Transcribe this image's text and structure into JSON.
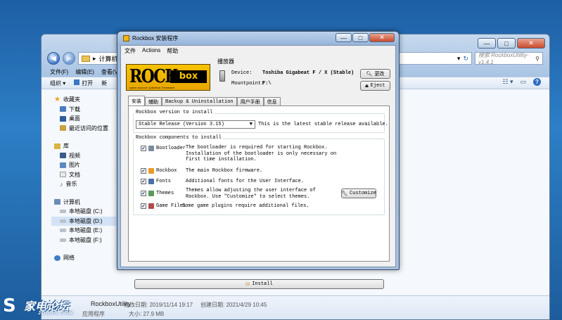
{
  "explorer": {
    "caption": {
      "minimize": "—",
      "maximize": "□",
      "close": "✕"
    },
    "breadcrumb": [
      "▸",
      "计算机",
      "▸"
    ],
    "search_placeholder": "搜索 RockboxUtility-v1.4.1",
    "menu": [
      "文件(F)",
      "编辑(E)",
      "查看(V)"
    ],
    "toolbar": {
      "organize": "组织 ▾",
      "open": "打开",
      "more": "新"
    },
    "nav": {
      "favorites": "收藏夹",
      "fav_items": [
        "下载",
        "桌面",
        "最近访问的位置"
      ],
      "libraries": "库",
      "lib_items": [
        "视频",
        "图片",
        "文档",
        "音乐"
      ],
      "computer": "计算机",
      "drives": [
        "本地磁盘 (C:)",
        "本地磁盘 (D:)",
        "本地磁盘 (E:)",
        "本地磁盘 (F:)"
      ],
      "network": "网络"
    },
    "status": {
      "name": "RockboxUtility",
      "type": "应用程序",
      "modified": "修改日期: 2019/11/14 19:17",
      "size": "大小: 27.9 MB",
      "created": "创建日期: 2021/4/29 10:45"
    }
  },
  "dialog": {
    "title": "Rockbox 安装程序",
    "menu": [
      "文件",
      "Actions",
      "帮助"
    ],
    "logo": {
      "text": "ROCK",
      "box": "box",
      "sub": "open source jukebox firmware"
    },
    "player_label": "播放器",
    "device_label": "Device:",
    "device_value": "Toshiba Gigabeat F / X (Stable)",
    "mountpoint_label": "Mountpoint:",
    "mountpoint_value": "F:\\",
    "change_button": "更改",
    "eject_button": "Eject",
    "tabs": [
      "安装",
      "辅助",
      "Backup & Uninstallation",
      "用户手册",
      "信息"
    ],
    "version_group": "Rockbox version to install",
    "version_selected": "Stable Release (Version 3.15)",
    "version_note": "This is the latest stable release available.",
    "components_group": "Rockbox components to install",
    "components": [
      {
        "name": "Bootloader",
        "desc": "The bootloader is required for starting Rockbox. Installation of the bootloader is only necessary on first time installation.",
        "color": "#7a8aa0"
      },
      {
        "name": "Rockbox",
        "desc": "The main Rockbox firmware.",
        "color": "#e89a2a"
      },
      {
        "name": "Fonts",
        "desc": "Additional fonts for the User Interface.",
        "color": "#4a6fa8"
      },
      {
        "name": "Themes",
        "desc": "Themes allow adjusting the user interface of Rockbox. Use \"Customize\" to select themes.",
        "color": "#5a9a5a"
      },
      {
        "name": "Game Files",
        "desc": "Some game plugins require additional files.",
        "color": "#b04a4a"
      }
    ],
    "customize_button": "Customize",
    "install_button": "Install"
  },
  "watermark": {
    "text": "家电论坛",
    "sub": "JDBBS.COM"
  }
}
